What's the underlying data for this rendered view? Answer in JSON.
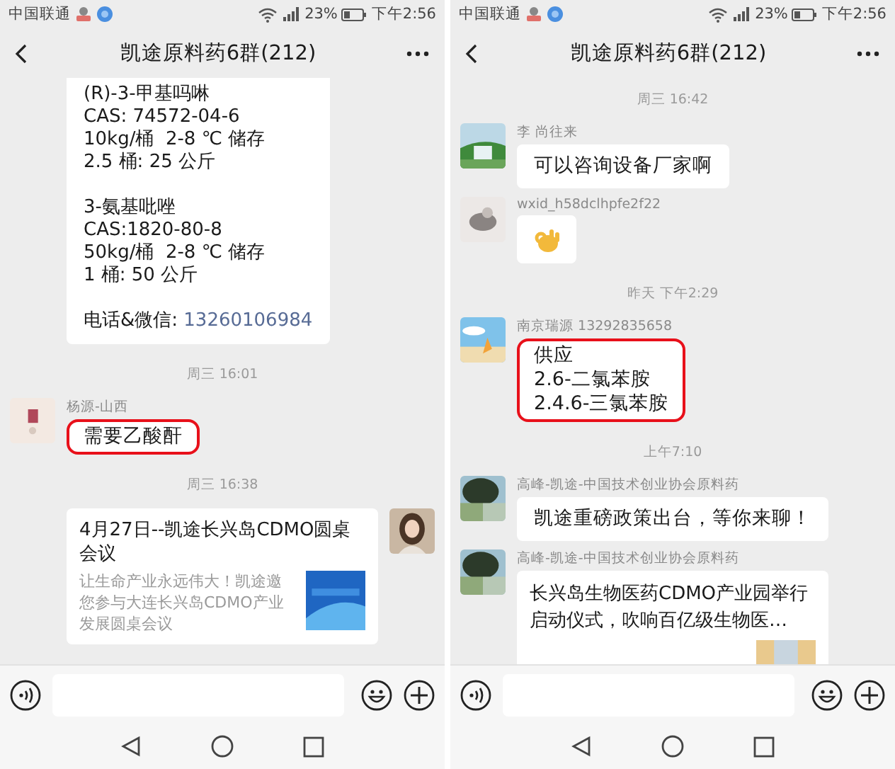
{
  "phones": [
    {
      "status_bar": {
        "carrier": "中国联通",
        "battery": "23%",
        "time": "下午2:56"
      },
      "title": "凯途原料药6群(212)",
      "messages": [
        {
          "kind": "text",
          "outgoing": false,
          "avatar": false,
          "cut_top": true,
          "highlighted": false,
          "paragraphs": [
            [
              "(R)-3-甲基吗啉",
              "CAS: 74572-04-6",
              "10kg/桶  2-8 ℃ 储存",
              "2.5 桶: 25 公斤"
            ],
            [
              "3-氨基吡唑",
              "CAS:1820-80-8",
              "50kg/桶  2-8 ℃ 储存",
              "1 桶: 50 公斤"
            ]
          ],
          "contact": {
            "label": "电话&微信: ",
            "number": "13260106984"
          }
        },
        {
          "kind": "timestamp",
          "text": "周三 16:01"
        },
        {
          "kind": "text",
          "outgoing": false,
          "avatar": true,
          "sender": "杨源-山西",
          "cut_top": false,
          "highlighted": true,
          "paragraphs": [
            [
              "需要乙酸酐"
            ]
          ]
        },
        {
          "kind": "timestamp",
          "text": "周三 16:38"
        },
        {
          "kind": "card",
          "outgoing": true,
          "avatar": true,
          "title": "4月27日--凯途长兴岛CDMO圆桌会议",
          "description": "让生命产业永远伟大！凯途邀您参与大连长兴岛CDMO产业发展圆桌会议"
        }
      ]
    },
    {
      "status_bar": {
        "carrier": "中国联通",
        "battery": "23%",
        "time": "下午2:56"
      },
      "title": "凯途原料药6群(212)",
      "messages": [
        {
          "kind": "timestamp",
          "text": "周三 16:42"
        },
        {
          "kind": "text",
          "outgoing": false,
          "avatar": true,
          "sender": "李 尚往来",
          "cut_top": false,
          "highlighted": false,
          "paragraphs": [
            [
              "可以咨询设备厂家啊"
            ]
          ]
        },
        {
          "kind": "sticker",
          "outgoing": false,
          "avatar": true,
          "sender": "wxid_h58dclhpfe2f22"
        },
        {
          "kind": "timestamp",
          "text": "昨天 下午2:29"
        },
        {
          "kind": "text",
          "outgoing": false,
          "avatar": true,
          "sender": "南京瑞源 13292835658",
          "cut_top": false,
          "highlighted": true,
          "paragraphs": [
            [
              "供应",
              "2.6-二氯苯胺",
              "2.4.6-三氯苯胺"
            ]
          ]
        },
        {
          "kind": "timestamp",
          "text": "上午7:10"
        },
        {
          "kind": "text",
          "outgoing": false,
          "avatar": true,
          "sender": "高峰-凯途-中国技术创业协会原料药",
          "cut_top": false,
          "highlighted": false,
          "paragraphs": [
            [
              "凯途重磅政策出台，等你来聊！"
            ]
          ]
        },
        {
          "kind": "link",
          "outgoing": false,
          "avatar": true,
          "sender": "高峰-凯途-中国技术创业协会原料药",
          "title": "长兴岛生物医药CDMO产业园举行启动仪式，吹响百亿级生物医…"
        }
      ]
    }
  ]
}
